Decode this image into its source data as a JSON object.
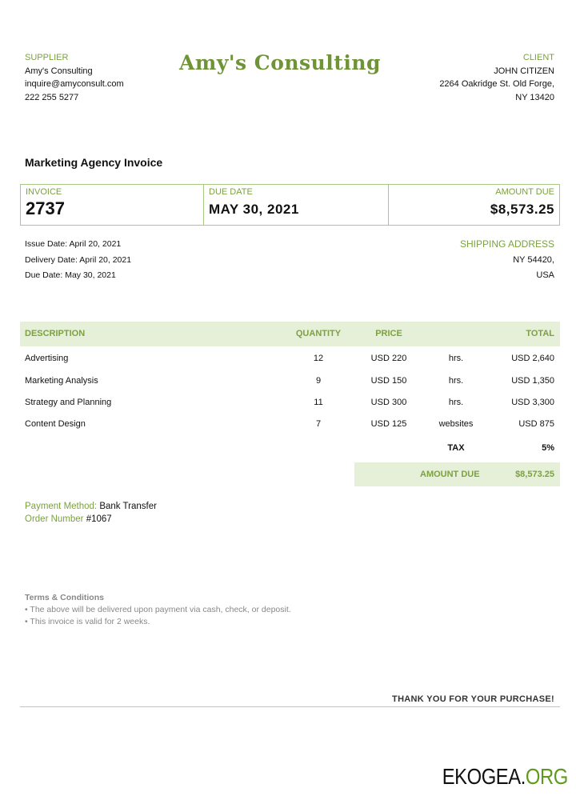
{
  "supplier": {
    "label": "SUPPLIER",
    "name": "Amy's Consulting",
    "email": "inquire@amyconsult.com",
    "phone": "222 255 5277"
  },
  "logo": "Amy's Consulting",
  "client": {
    "label": "CLIENT",
    "name": "JOHN CITIZEN",
    "address1": "2264 Oakridge St. Old Forge,",
    "address2": "NY 13420"
  },
  "title": "Marketing Agency Invoice",
  "summary": {
    "invoice_label": "INVOICE",
    "invoice_no": "2737",
    "due_label": "DUE DATE",
    "due_date": "MAY 30, 2021",
    "amount_label": "AMOUNT DUE",
    "amount": "$8,573.25"
  },
  "dates": {
    "issue": "Issue Date:  April 20, 2021",
    "delivery": "Delivery Date: April 20, 2021",
    "due": "Due Date: May 30, 2021"
  },
  "shipping": {
    "label": "SHIPPING ADDRESS",
    "line1": "NY 54420,",
    "line2": "USA"
  },
  "table": {
    "headers": [
      "DESCRIPTION",
      "QUANTITY",
      "PRICE",
      "",
      "TOTAL"
    ],
    "rows": [
      [
        "Advertising",
        "12",
        "USD 220",
        "hrs.",
        "USD 2,640"
      ],
      [
        "Marketing Analysis",
        "9",
        "USD 150",
        "hrs.",
        "USD 1,350"
      ],
      [
        "Strategy and Planning",
        "11",
        "USD 300",
        "hrs.",
        "USD 3,300"
      ],
      [
        "Content Design",
        "7",
        "USD 125",
        "websites",
        "USD 875"
      ]
    ],
    "tax_label": "TAX",
    "tax": "5%",
    "due_label": "AMOUNT DUE",
    "due": "$8,573.25"
  },
  "payment": {
    "method_label": "Payment  Method:",
    "method": "Bank Transfer",
    "order_label": "Order Number",
    "order": "#1067"
  },
  "terms": {
    "title": "Terms & Conditions",
    "items": [
      "• The above will be delivered upon payment via cash, check, or deposit.",
      "• This invoice is valid for 2 weeks."
    ]
  },
  "thanks": "THANK YOU FOR YOUR PURCHASE!",
  "watermark": {
    "a": "EKOGEA.",
    "b": "ORG"
  },
  "colors": {
    "accent": "#7aa23e",
    "header_bg": "#e6efd8"
  }
}
